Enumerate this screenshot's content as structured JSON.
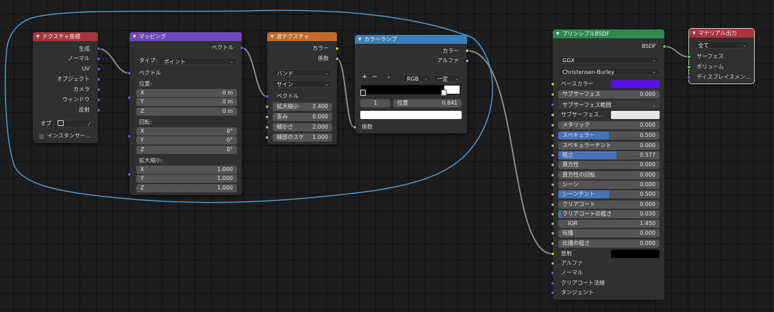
{
  "nodes": {
    "texcoord": {
      "title": "テクスチャ座標",
      "outputs": [
        "生成",
        "ノーマル",
        "UV",
        "オブジェクト",
        "カメラ",
        "ウィンドウ",
        "反射"
      ],
      "object_label": "オブ",
      "instancer_label": "インスタンサー..."
    },
    "mapping": {
      "title": "マッピング",
      "output_vector": "ベクトル",
      "type_label": "タイプ:",
      "type_value": "ポイント",
      "input_vector": "ベクトル",
      "location_label": "位置:",
      "location": [
        {
          "axis": "X",
          "value": "0 m"
        },
        {
          "axis": "Y",
          "value": "0 m"
        },
        {
          "axis": "Z",
          "value": "0 m"
        }
      ],
      "rotation_label": "回転:",
      "rotation": [
        {
          "axis": "X",
          "value": "0°"
        },
        {
          "axis": "Y",
          "value": "0°"
        },
        {
          "axis": "Z",
          "value": "0°"
        }
      ],
      "scale_label": "拡大縮小:",
      "scale": [
        {
          "axis": "X",
          "value": "1.000"
        },
        {
          "axis": "Y",
          "value": "1.000"
        },
        {
          "axis": "Z",
          "value": "1.000"
        }
      ]
    },
    "wave": {
      "title": "波テクスチャ",
      "out_color": "カラー",
      "out_fac": "係数",
      "wave_type": "バンド",
      "profile": "サイン",
      "in_vector": "ベクトル",
      "fields": [
        {
          "label": "拡大縮小",
          "value": "2.400"
        },
        {
          "label": "歪み",
          "value": "0.000"
        },
        {
          "label": "細かさ",
          "value": "2.000"
        },
        {
          "label": "細部のスケ",
          "value": "1.000"
        }
      ]
    },
    "colorramp": {
      "title": "カラーランプ",
      "out_color": "カラー",
      "out_alpha": "アルファ",
      "add_btn": "+",
      "remove_btn": "−",
      "color_mode": "RGB",
      "interpolation": "一定",
      "stop_index": "1",
      "pos_label": "位置",
      "pos_value": "0.841",
      "in_fac": "係数"
    },
    "bsdf": {
      "title": "プリンシプルBSDF",
      "out": "BSDF",
      "distribution": "GGX",
      "subsurface_method": "Christensen-Burley",
      "base_color_label": "ベースカラー",
      "base_color": "#5a10e0",
      "subsurface": {
        "label": "サブサーフェス",
        "value": "0.000",
        "fill": 0
      },
      "subsurface_radius": "サブサーフェス範囲",
      "subsurface_color_label": "サブサーフェス...",
      "subsurface_color": "#e6e6e6",
      "metallic": {
        "label": "メタリック",
        "value": "0.000",
        "fill": 0
      },
      "specular": {
        "label": "スペキュラー",
        "value": "0.500",
        "fill": 0.5
      },
      "specular_tint": {
        "label": "スペキュラーチント",
        "value": "0.000",
        "fill": 0
      },
      "roughness": {
        "label": "粗さ",
        "value": "0.577",
        "fill": 0.577
      },
      "anisotropic": {
        "label": "異方性",
        "value": "0.000",
        "fill": 0
      },
      "anisotropic_rotation": {
        "label": "異方性の回転",
        "value": "0.000",
        "fill": 0
      },
      "sheen": {
        "label": "シーン",
        "value": "0.000",
        "fill": 0
      },
      "sheen_tint": {
        "label": "シーンチント",
        "value": "0.500",
        "fill": 0.5
      },
      "clearcoat": {
        "label": "クリアコート",
        "value": "0.000",
        "fill": 0
      },
      "clearcoat_roughness": {
        "label": "クリアコートの粗さ",
        "value": "0.030",
        "fill": 0.03
      },
      "ior": {
        "label": "IOR",
        "value": "1.450",
        "fill": 0
      },
      "transmission": {
        "label": "伝播",
        "value": "0.000",
        "fill": 0
      },
      "transmission_roughness": {
        "label": "伝播の粗さ",
        "value": "0.000",
        "fill": 0
      },
      "emission_label": "放射",
      "emission_color": "#000000",
      "alpha": "アルファ",
      "normal": "ノーマル",
      "clearcoat_normal": "クリアコート法線",
      "tangent": "タンジェント"
    },
    "output": {
      "title": "マテリアル出力",
      "target": "全て",
      "inputs": [
        "サーフェス",
        "ボリューム",
        "ディスプレイスメン..."
      ]
    }
  },
  "colors": {
    "header_input": "#a8343f",
    "header_vector": "#6c48b8",
    "header_texture": "#c56b2a",
    "header_converter": "#3b80b8",
    "header_shader": "#2e8a4f",
    "header_output": "#a8343f",
    "socket_vector": "#6363c7",
    "socket_color": "#c7c729",
    "socket_float": "#a1a1a1",
    "socket_shader": "#63c763",
    "field_fill": "#4772b3",
    "lasso": "#4a9fd6"
  },
  "icons": {
    "collapse": "triangle-down-icon",
    "object": "object-icon",
    "eyedropper": "eyedropper-icon",
    "dropdown": "chevron-down-icon"
  }
}
